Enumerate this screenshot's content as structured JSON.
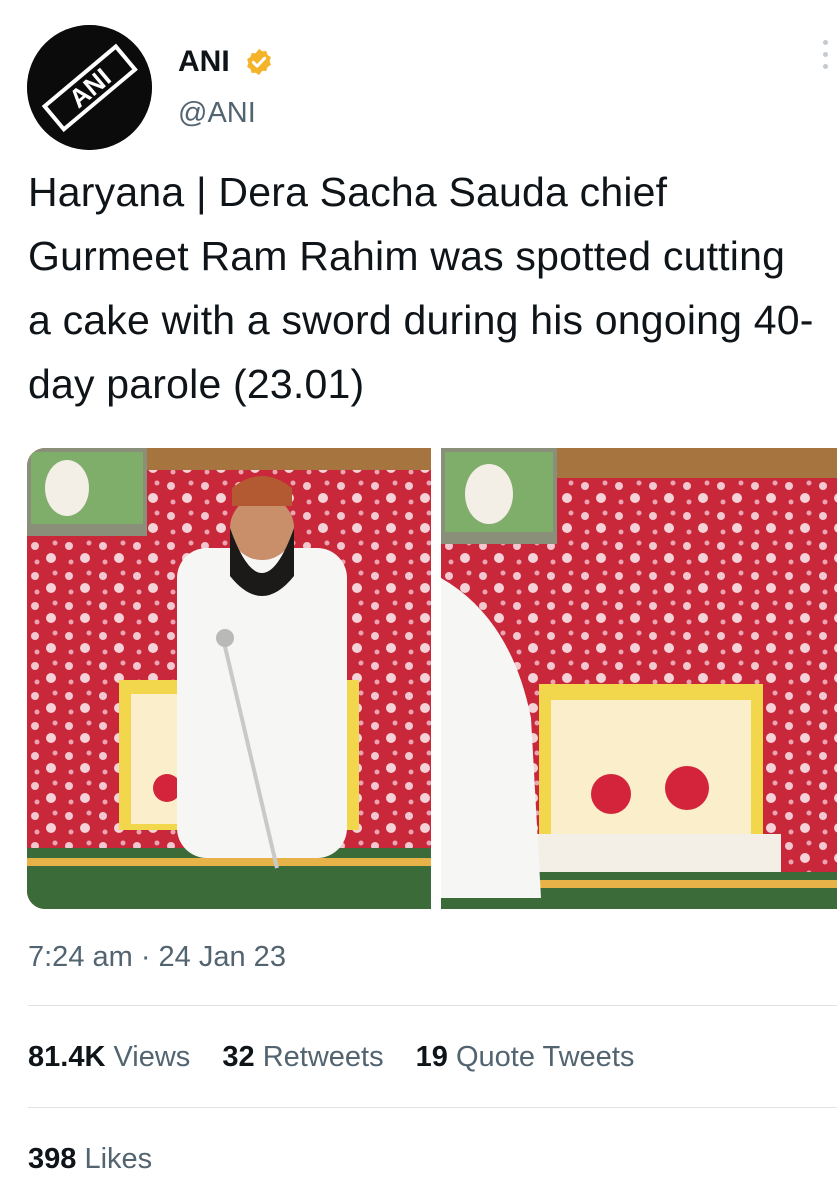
{
  "author": {
    "display_name": "ANI",
    "handle": "@ANI",
    "avatar_label": "ANI",
    "avatar_icon": "ani-logo",
    "verified_icon": "verified-badge-icon",
    "verified_color": "#F4B42A"
  },
  "tweet": {
    "text": "Haryana | Dera Sacha Sauda chief Gurmeet Ram Rahim was spotted cutting a cake with a sword during his ongoing 40-day parole (23.01)",
    "timestamp": "7:24 am · 24 Jan 23"
  },
  "media": [
    {
      "description": "photo-left",
      "icon": "photo"
    },
    {
      "description": "photo-right",
      "icon": "photo"
    }
  ],
  "stats": {
    "views_count": "81.4K",
    "views_label": "Views",
    "retweets_count": "32",
    "retweets_label": "Retweets",
    "quotes_count": "19",
    "quotes_label": "Quote Tweets",
    "likes_count": "398",
    "likes_label": "Likes"
  },
  "colors": {
    "text_primary": "#0F1419",
    "text_secondary": "#536471",
    "divider": "#DFE3E6"
  }
}
